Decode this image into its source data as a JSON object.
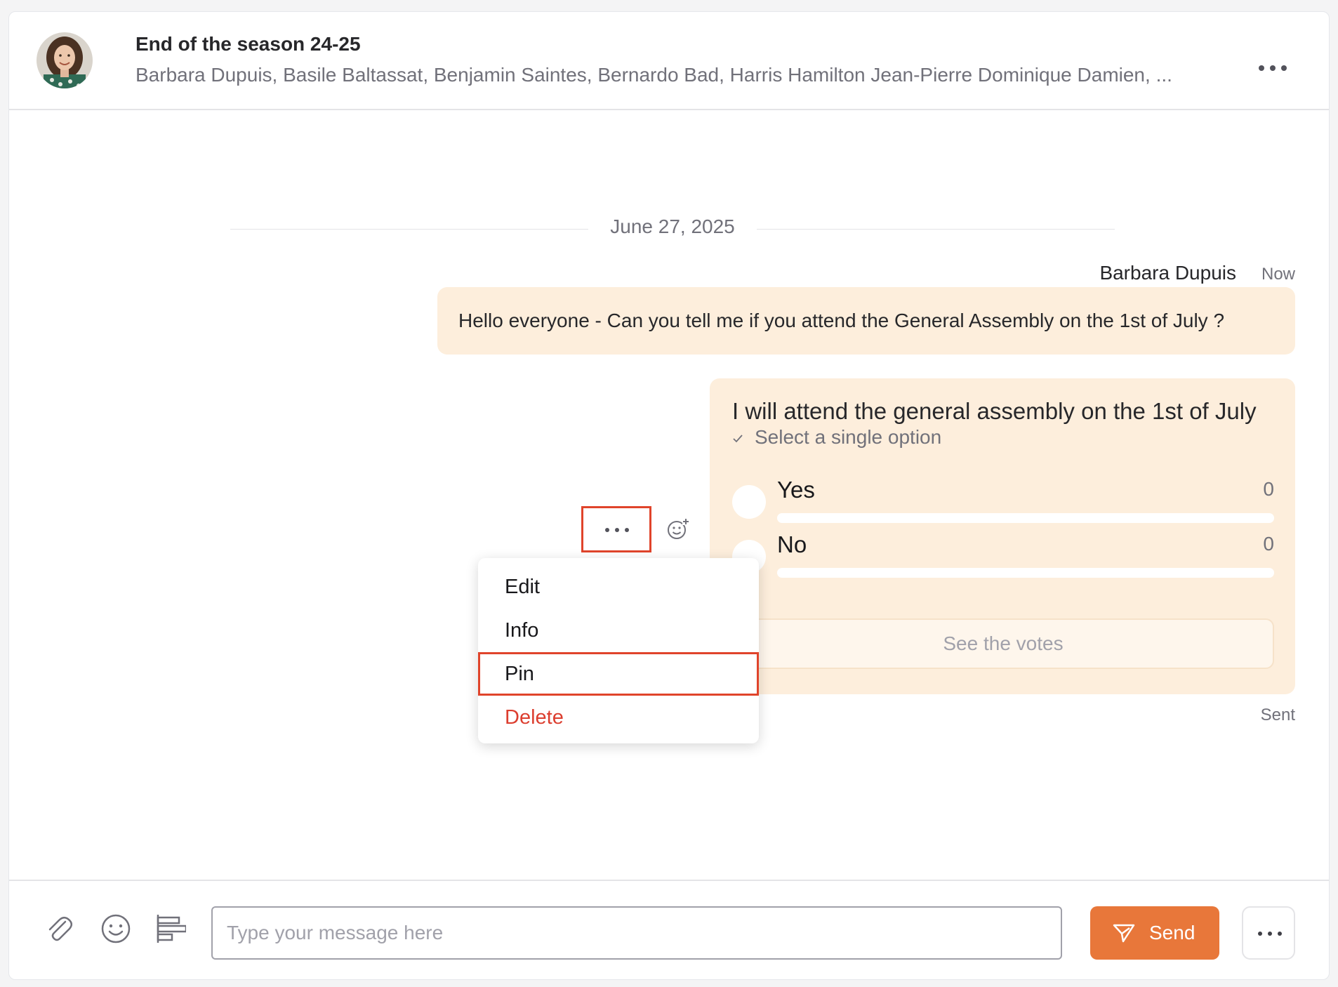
{
  "header": {
    "title": "End of the season 24-25",
    "participants": "Barbara Dupuis, Basile Baltassat, Benjamin Saintes, Bernardo Bad, Harris Hamilton Jean-Pierre Dominique Damien, ...",
    "avatar_icon": "profile-photo",
    "more_icon": "more-horizontal-icon"
  },
  "date_separator": "June 27, 2025",
  "message": {
    "sender": "Barbara Dupuis",
    "time": "Now",
    "text": "Hello everyone - Can you tell me if you attend the General Assembly on the 1st of July ?"
  },
  "poll": {
    "question": "I will attend the general assembly on the 1st of July",
    "hint": "Select a single option",
    "options": [
      {
        "label": "Yes",
        "count": "0",
        "fraction": 0
      },
      {
        "label": "No",
        "count": "0",
        "fraction": 0
      }
    ],
    "see_votes_label": "See the votes",
    "status": "Sent"
  },
  "context_menu": {
    "items": [
      {
        "label": "Edit"
      },
      {
        "label": "Info"
      },
      {
        "label": "Pin"
      },
      {
        "label": "Delete"
      }
    ]
  },
  "composer": {
    "placeholder": "Type your message here",
    "value": "",
    "send_label": "Send",
    "icons": [
      "paperclip-icon",
      "emoji-icon",
      "poll-icon",
      "send-icon",
      "more-horizontal-icon"
    ]
  },
  "colors": {
    "accent": "#e8773a",
    "bubble": "#fdeedc",
    "danger": "#dc3e2f",
    "highlight_outline": "#e0442b"
  }
}
